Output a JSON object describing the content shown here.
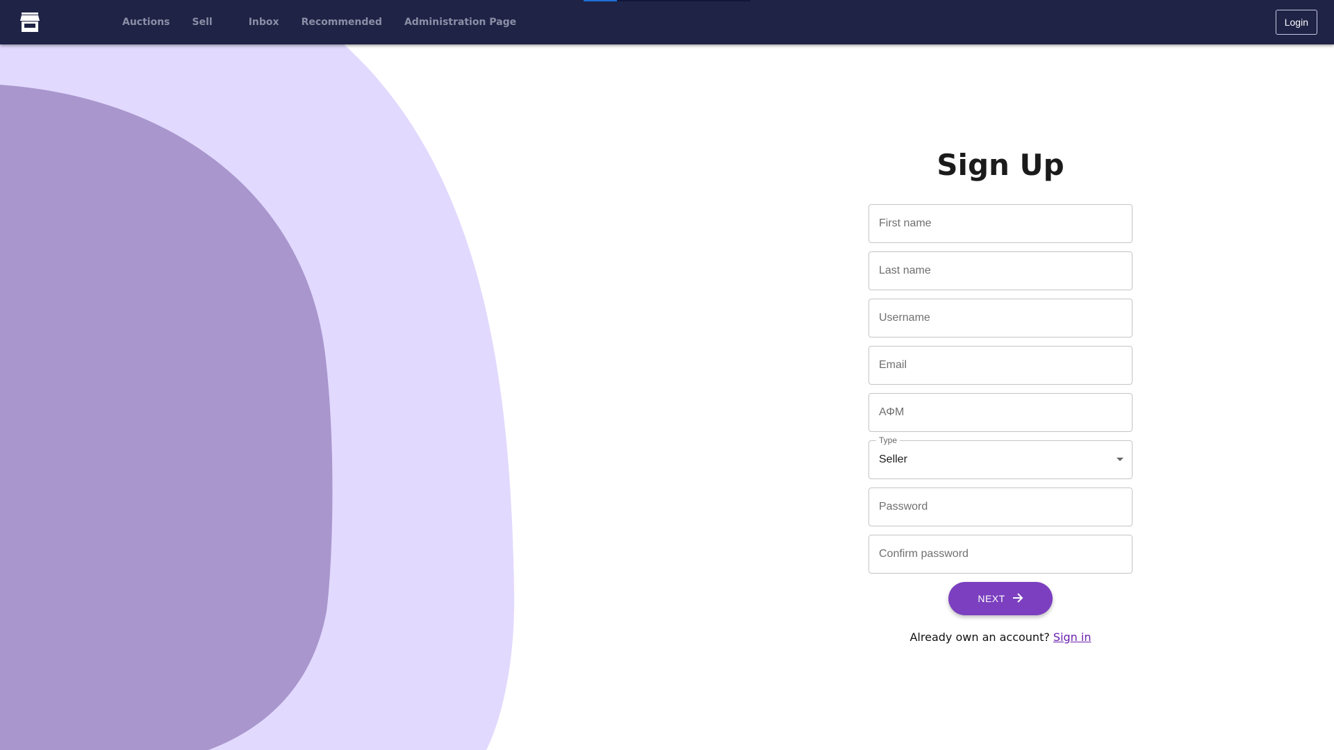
{
  "nav": {
    "items": [
      {
        "label": "Auctions"
      },
      {
        "label": "Sell"
      },
      {
        "label": "Inbox"
      },
      {
        "label": "Recommended"
      },
      {
        "label": "Administration Page"
      }
    ],
    "login_label": "Login",
    "logo_icon": "store-icon"
  },
  "colors": {
    "navbar": "#1f2346",
    "blob_light": "#e2d9fe",
    "blob_dark": "#a896cd",
    "accent": "#7b3fbf"
  },
  "form": {
    "title": "Sign Up",
    "fields": {
      "first_name": {
        "placeholder": "First name",
        "value": ""
      },
      "last_name": {
        "placeholder": "Last name",
        "value": ""
      },
      "username": {
        "placeholder": "Username",
        "value": ""
      },
      "email": {
        "placeholder": "Email",
        "value": ""
      },
      "afm": {
        "placeholder": "ΑΦΜ",
        "value": ""
      },
      "password": {
        "placeholder": "Password",
        "value": ""
      },
      "confirm_password": {
        "placeholder": "Confirm password",
        "value": ""
      }
    },
    "type": {
      "label": "Type",
      "value": "Seller"
    },
    "next_label": "NEXT",
    "next_icon": "arrow-right-icon",
    "account_prompt": "Already own an account?",
    "signin_label": "Sign in"
  }
}
